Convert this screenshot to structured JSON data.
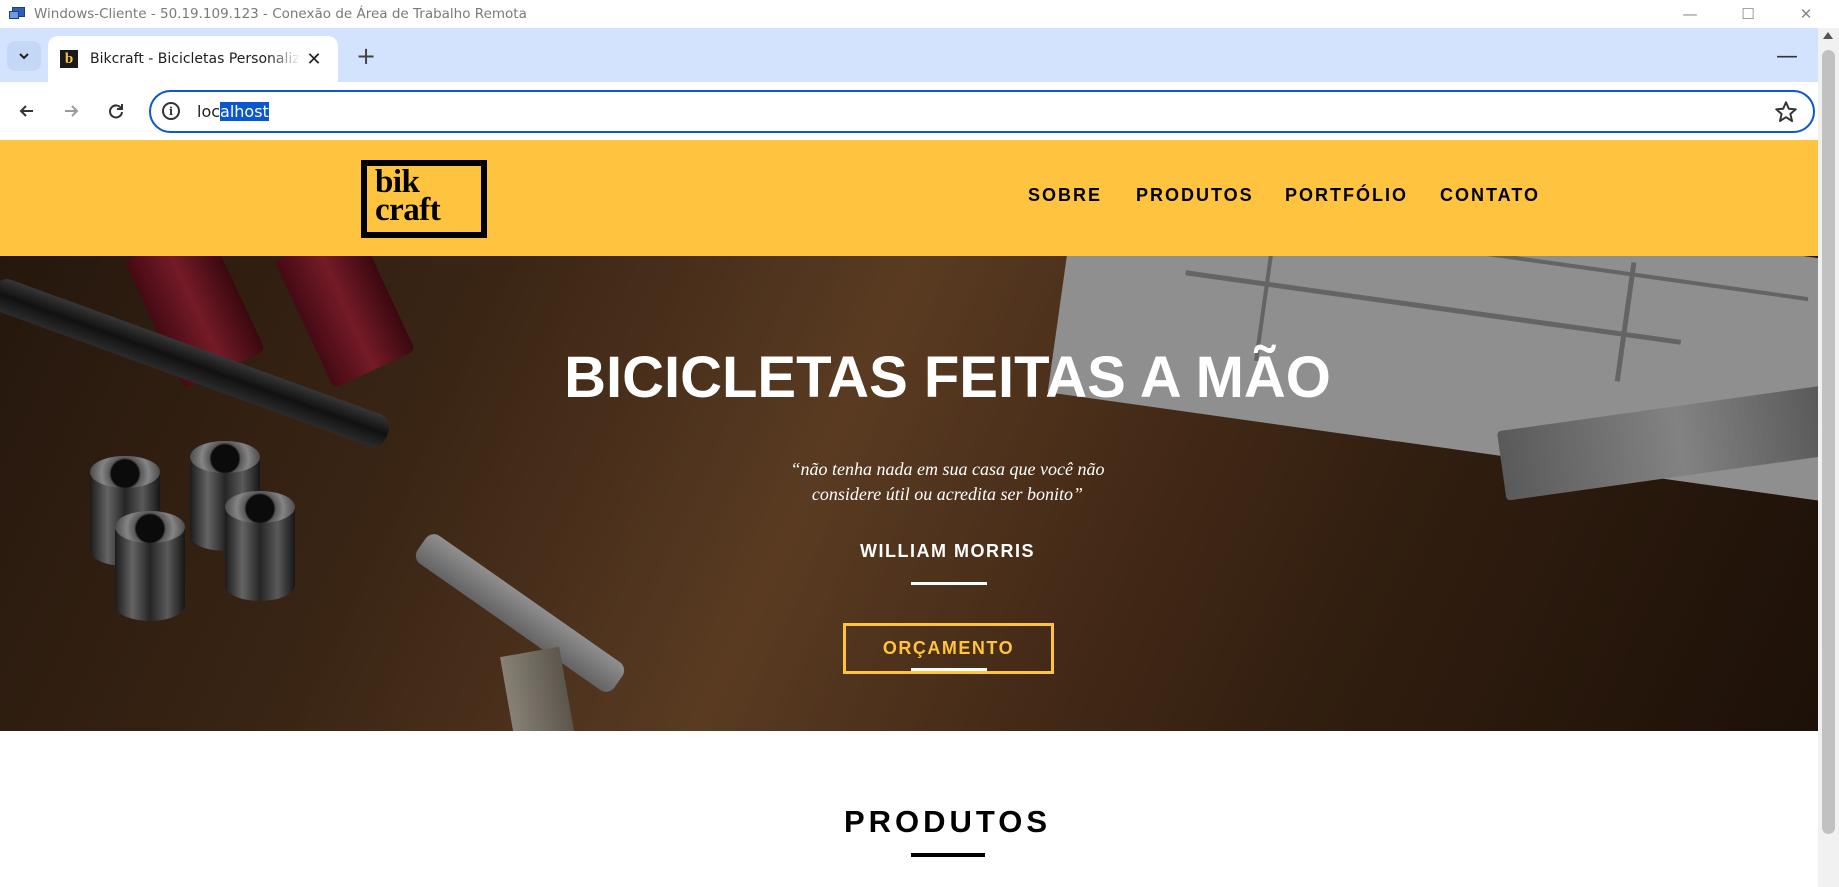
{
  "window": {
    "title": "Windows-Cliente - 50.19.109.123 - Conexão de Área de Trabalho Remota",
    "controls": {
      "minimize": "—",
      "maximize": "☐",
      "close": "✕"
    }
  },
  "browser": {
    "tab": {
      "title": "Bikcraft - Bicicletas Personalizadas",
      "favicon_letter": "b"
    },
    "tab_close": "✕",
    "new_tab": "+",
    "tabstrip_minimize": "—",
    "address": {
      "url_plain": "loc",
      "url_selected": "alhost"
    },
    "icons": [
      "chevron-down-icon",
      "back-icon",
      "forward-icon",
      "reload-icon",
      "info-icon",
      "star-icon"
    ]
  },
  "site": {
    "logo": {
      "line1": "bik",
      "line2": "craft"
    },
    "menu": [
      {
        "label": "SOBRE"
      },
      {
        "label": "PRODUTOS"
      },
      {
        "label": "PORTFÓLIO"
      },
      {
        "label": "CONTATO"
      }
    ],
    "hero": {
      "title": "BICICLETAS FEITAS A MÃO",
      "quote_line1": "“não tenha nada em sua casa que você não",
      "quote_line2": "considere útil ou acredita ser bonito”",
      "author": "WILLIAM MORRIS",
      "cta": "ORÇAMENTO"
    },
    "section": {
      "title": "PRODUTOS"
    }
  },
  "colors": {
    "brand_yellow": "#fec33f",
    "omnibox_focus": "#0b57d0",
    "tabstrip": "#d3e3fd"
  }
}
